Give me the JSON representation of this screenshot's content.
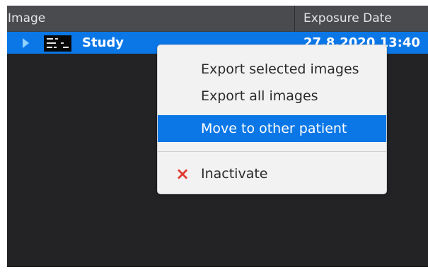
{
  "table": {
    "columns": {
      "image": "Image",
      "exposure_date": "Exposure Date"
    },
    "row": {
      "label": "Study",
      "exposure_date": "27.8.2020 13:40",
      "expand_icon": "expand-right-icon",
      "thumbnail_icon": "image-thumbnail-icon"
    }
  },
  "context_menu": {
    "items": [
      {
        "label": "Export selected images"
      },
      {
        "label": "Export all images"
      },
      {
        "label": "Move to other patient",
        "highlighted": true
      },
      {
        "label": "Inactivate",
        "icon": "close-icon",
        "icon_color": "#e03c31"
      }
    ],
    "highlight_color": "#0b77e7"
  },
  "colors": {
    "panel_bg": "#232325",
    "header_bg": "#4a4b4e",
    "selected_row_bg": "#0b77e7",
    "menu_bg": "#f2f2f2"
  }
}
